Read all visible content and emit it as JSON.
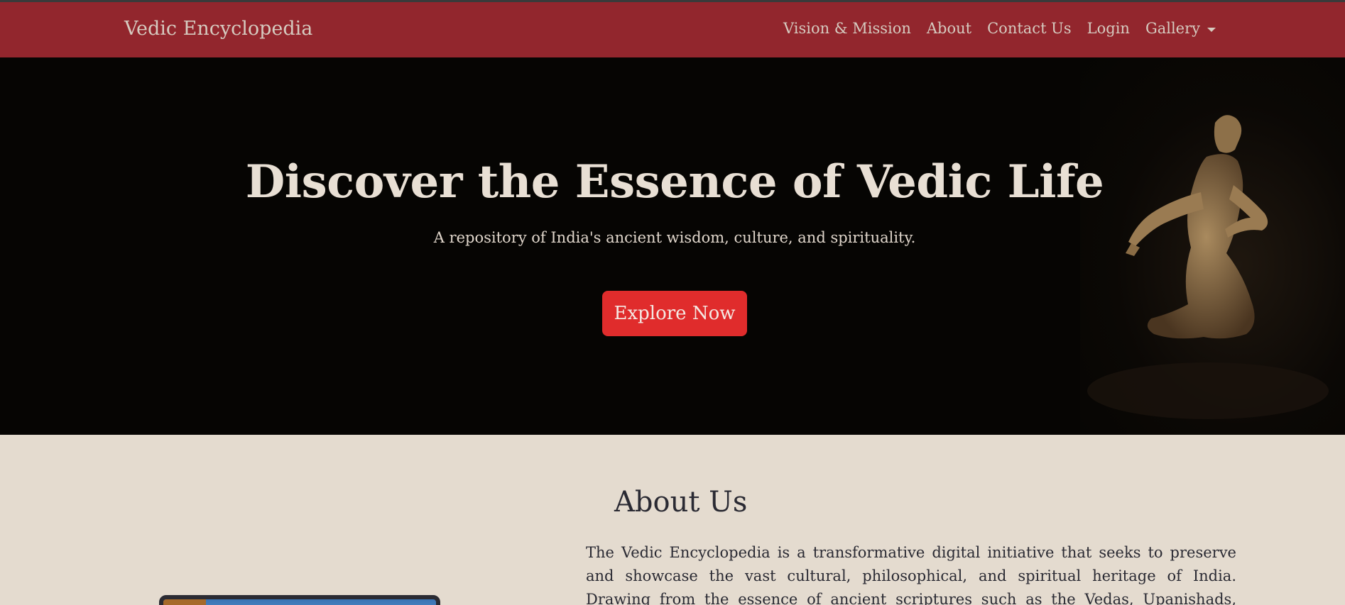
{
  "navbar": {
    "brand": "Vedic Encyclopedia",
    "links": [
      "Vision & Mission",
      "About",
      "Contact Us",
      "Login"
    ],
    "gallery_label": "Gallery"
  },
  "hero": {
    "title": "Discover the Essence of Vedic Life",
    "subtitle": "A repository of India's ancient wisdom, culture, and spirituality.",
    "button_label": "Explore Now"
  },
  "about": {
    "title": "About Us",
    "text": "The Vedic Encyclopedia is a transformative digital initiative that seeks to preserve and showcase the vast cultural, philosophical, and spiritual heritage of India. Drawing from the essence of ancient scriptures such as the Vedas, Upanishads, Puranas, and Epics, alongside"
  },
  "colors": {
    "navbar_bg": "#92262d",
    "hero_bg": "#060503",
    "accent_button": "#e02c2c",
    "page_bg": "#e4dbcf"
  }
}
